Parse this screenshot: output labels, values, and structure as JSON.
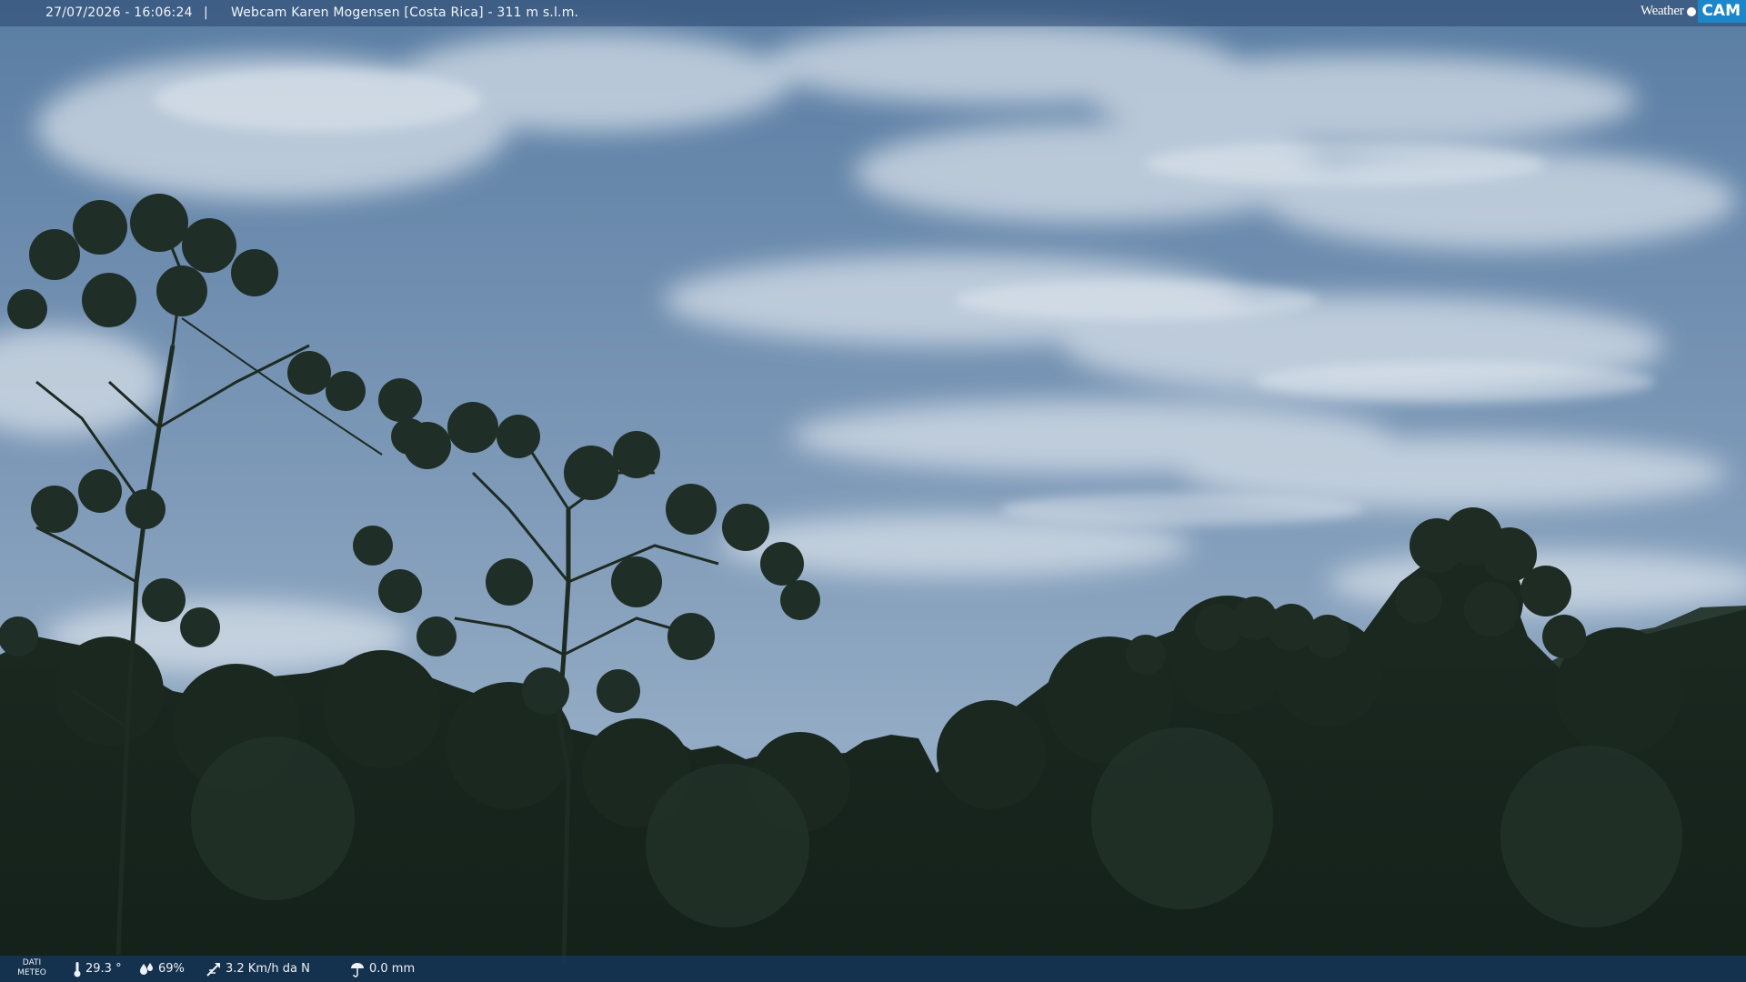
{
  "header": {
    "timestamp": "27/07/2026 - 16:06:24",
    "separator": "|",
    "title": "Webcam Karen Mogensen [Costa Rica]  - 311 m s.l.m."
  },
  "logo": {
    "part1": "Weather",
    "part2": "CAM"
  },
  "footer": {
    "dati_line1": "DATI",
    "dati_line2": "METEO",
    "temperature": "29.3 °",
    "humidity": "69%",
    "wind": "3.2 Km/h da N",
    "rain": "0.0 mm"
  },
  "icons": {
    "temperature": "thermometer-icon",
    "humidity": "humidity-drop-icon",
    "wind": "wind-icon",
    "rain": "rain-gauge-icon"
  }
}
